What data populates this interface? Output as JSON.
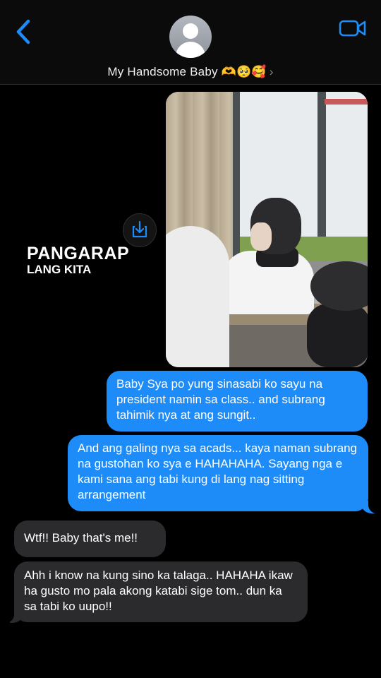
{
  "header": {
    "contact_name": "My Handsome Baby 🫶🥺🥰",
    "chevron": "›",
    "back_icon": "chevron-left-icon",
    "video_icon": "video-camera-icon",
    "accent_color": "#1d8cf8"
  },
  "image_message": {
    "overlay_line1": "PANGARAP",
    "overlay_line2": "LANG KITA",
    "save_icon": "download-icon"
  },
  "messages": [
    {
      "direction": "outgoing",
      "text": "Baby Sya po yung sinasabi ko sayu na president namin sa class.. and subrang tahimik nya at ang sungit.."
    },
    {
      "direction": "outgoing",
      "text": "And ang galing nya sa acads... kaya naman subrang na gustohan ko sya e HAHAHAHA. Sayang nga e kami sana ang tabi kung di lang nag sitting arrangement"
    },
    {
      "direction": "incoming",
      "text": "Wtf!! Baby that's me!!"
    },
    {
      "direction": "incoming",
      "text": "Ahh i know na kung sino ka talaga.. HAHAHA ikaw ha gusto mo pala akong katabi sige tom.. dun ka sa tabi ko uupo!!"
    }
  ]
}
